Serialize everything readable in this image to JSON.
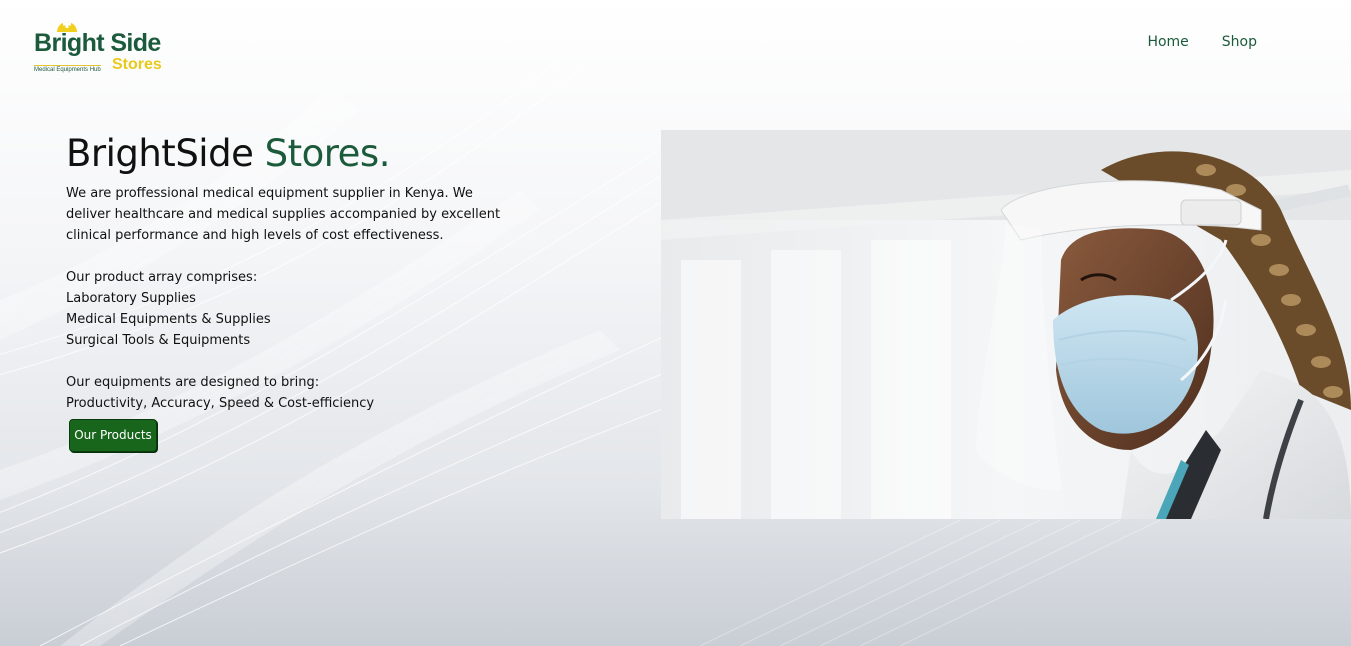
{
  "header": {
    "logo": {
      "name_top": "Bright Side",
      "name_bottom": "Stores",
      "tagline": "Medical Equipments Hub"
    },
    "nav": [
      {
        "label": "Home"
      },
      {
        "label": "Shop"
      }
    ]
  },
  "hero": {
    "title_part1": "BrightSide ",
    "title_part2": "Stores",
    "title_part3": ".",
    "intro_lines": [
      "We are proffessional medical equipment supplier in Kenya. We",
      "deliver healthcare and medical supplies accompanied by excellent",
      "clinical performance and high levels of cost effectiveness."
    ],
    "products_heading": "Our product array comprises:",
    "products": [
      "Laboratory Supplies",
      "Medical Equipments & Supplies",
      "Surgical Tools & Equipments"
    ],
    "benefits_heading": "Our equipments are designed to bring:",
    "benefits": "Productivity, Accuracy, Speed & Cost-efficiency",
    "cta_label": "Our Products"
  },
  "colors": {
    "brand_green": "#1c5a3c",
    "brand_yellow": "#e8c91c",
    "cta_green": "#17661c"
  },
  "images": {
    "hero_photo": "healthcare-worker-face-shield-mask-photo"
  }
}
